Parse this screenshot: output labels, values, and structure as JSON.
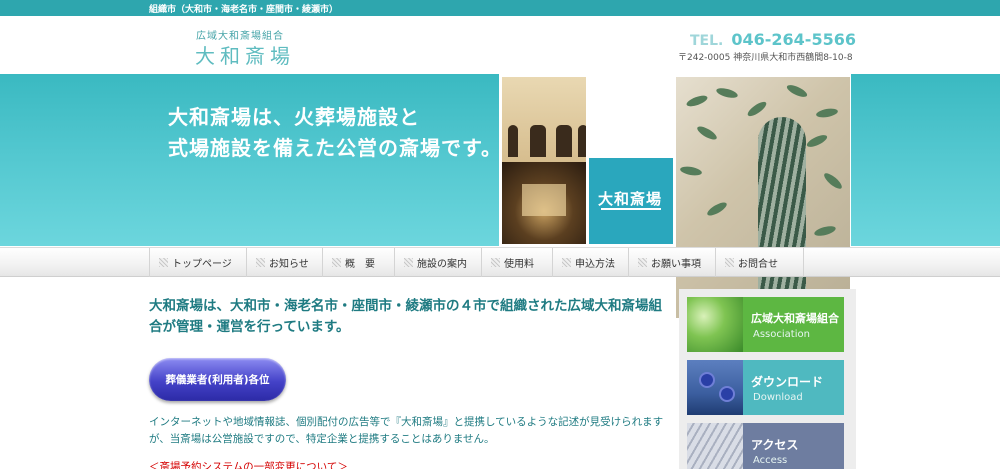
{
  "topbar": {
    "text": "組織市（大和市・海老名市・座間市・綾瀬市）"
  },
  "header": {
    "logo_sub": "広域大和斎場組合",
    "logo_main": "大和斎場",
    "tel_prefix": "TEL.",
    "tel_number": "046-264-5566",
    "address": "〒242-0005 神奈川県大和市西鶴間8-10-8"
  },
  "hero": {
    "line1": "大和斎場は、火葬場施設と",
    "line2": "式場施設を備えた公営の斎場です。",
    "name_box": "大和斎場"
  },
  "nav": {
    "items": [
      {
        "label": "トップページ"
      },
      {
        "label": "お知らせ"
      },
      {
        "label": "概　要"
      },
      {
        "label": "施設の案内"
      },
      {
        "label": "使用料"
      },
      {
        "label": "申込方法"
      },
      {
        "label": "お願い事項"
      },
      {
        "label": "お問合せ"
      }
    ]
  },
  "main": {
    "intro": "大和斎場は、大和市・海老名市・座間市・綾瀬市の４市で組織された広域大和斎場組合が管理・運営を行っています。",
    "button_label": "葬儀業者(利用者)各位",
    "notice": "インターネットや地域情報誌、個別配付の広告等で『大和斎場』と提携しているような記述が見受けられますが、当斎場は公営施設ですので、特定企業と提携することはありません。",
    "red_link": "＜斎場予約システムの一部変更について＞"
  },
  "sidebar": {
    "banners": [
      {
        "title": "広域大和斎場組合",
        "sub": "Association"
      },
      {
        "title": "ダウンロード",
        "sub": "Download"
      },
      {
        "title": "アクセス",
        "sub": "Access"
      }
    ]
  },
  "colors": {
    "teal": "#2ea6ae",
    "hero_gradient_top": "#3ab9c1",
    "text_teal": "#1f7b82",
    "alert_red": "#d40000",
    "green_banner": "#5db742",
    "blue_banner": "#4fb9c0",
    "slate_banner": "#6e7da0"
  }
}
